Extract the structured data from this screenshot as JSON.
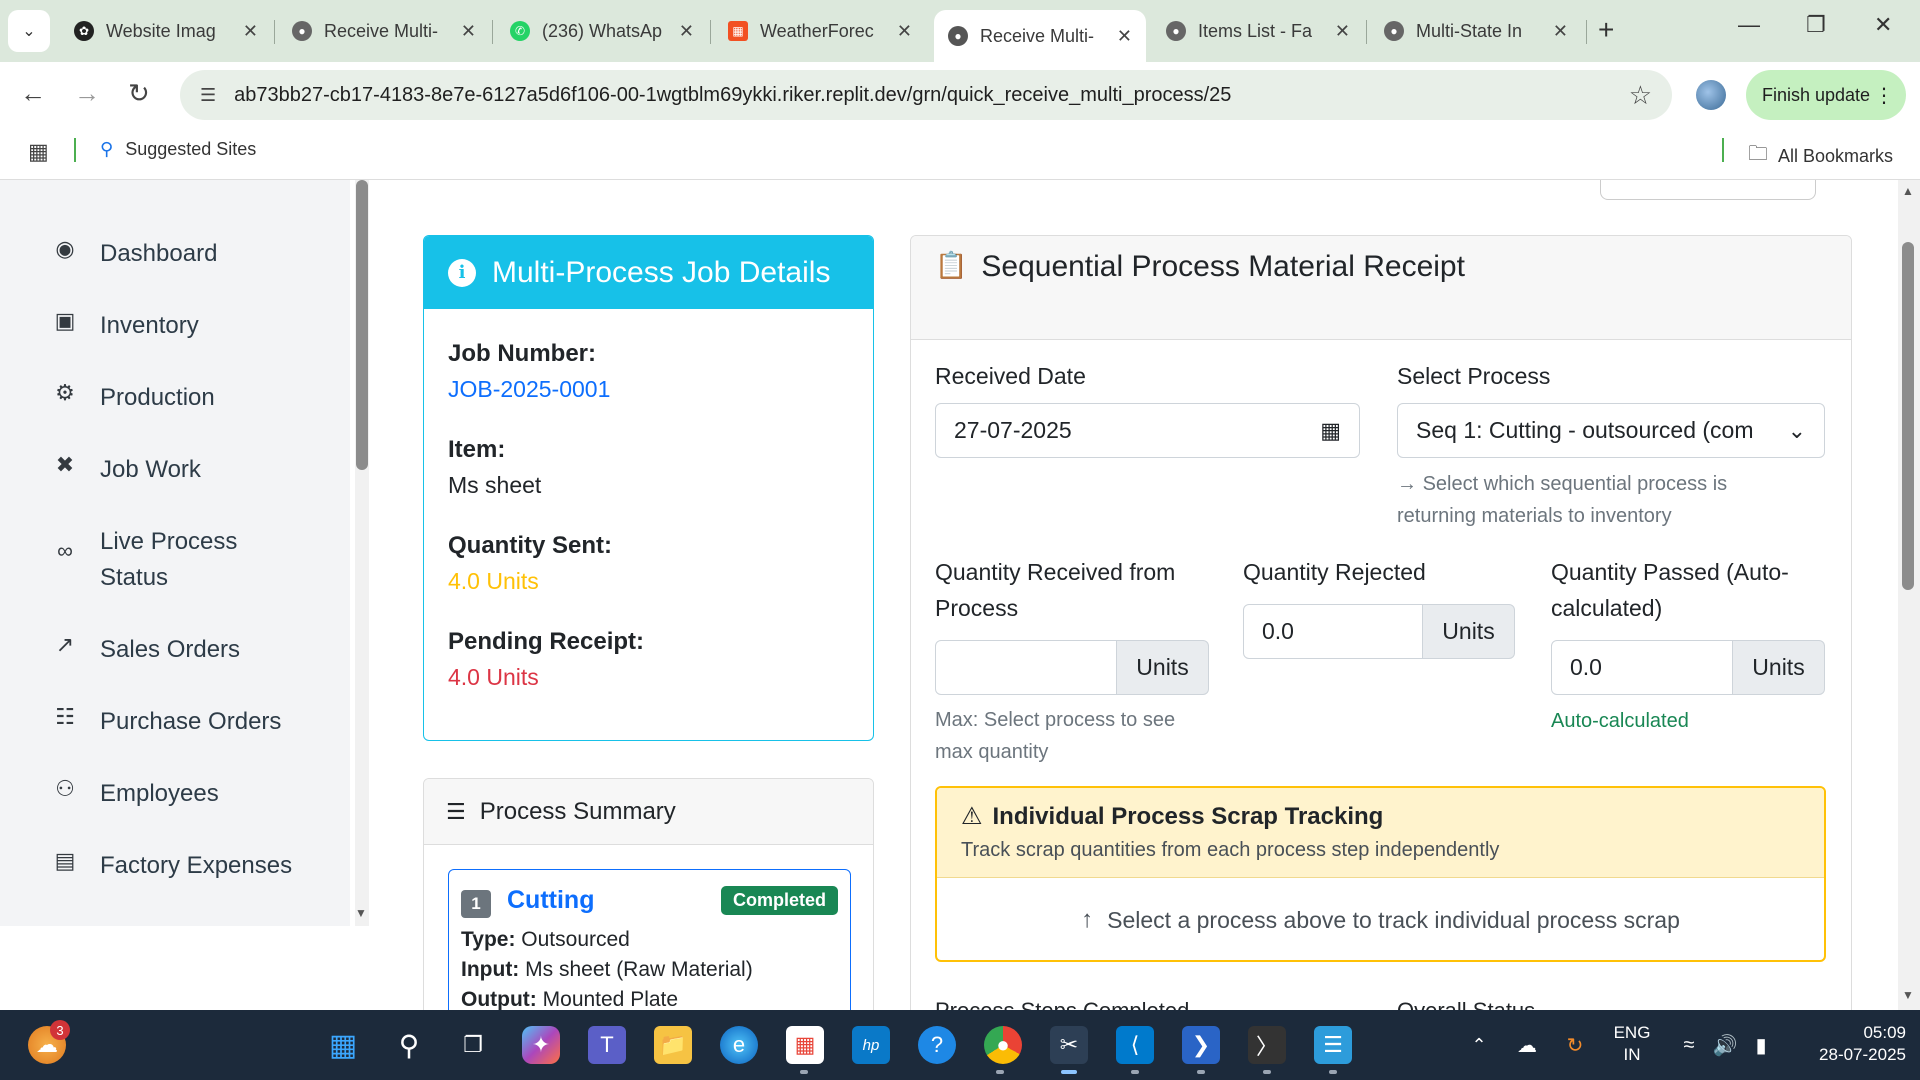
{
  "browser": {
    "tabs": [
      {
        "title": "Website Imag",
        "icon": "openai-icon",
        "color": "#222222"
      },
      {
        "title": "Receive Multi-",
        "icon": "globe-icon",
        "color": "#555555"
      },
      {
        "title": "(236) WhatsAp",
        "icon": "whatsapp-icon",
        "color": "#25d366"
      },
      {
        "title": "WeatherForec",
        "icon": "grid-icon",
        "color": "#f25022"
      },
      {
        "title": "Receive Multi-",
        "icon": "globe-icon",
        "color": "#555555",
        "active": true
      },
      {
        "title": "Items List - Fa",
        "icon": "globe-icon",
        "color": "#555555"
      },
      {
        "title": "Multi-State In",
        "icon": "globe-icon",
        "color": "#555555"
      }
    ],
    "url": "ab73bb27-cb17-4183-8e7e-6127a5d6f106-00-1wgtblm69ykki.riker.replit.dev/grn/quick_receive_multi_process/25",
    "finish_update": "Finish update",
    "bookmarks": {
      "suggested": "Suggested Sites",
      "all": "All Bookmarks"
    }
  },
  "sidebar": {
    "items": [
      {
        "label": "Dashboard",
        "icon": "palette-icon"
      },
      {
        "label": "Inventory",
        "icon": "boxes-icon"
      },
      {
        "label": "Production",
        "icon": "cogs-icon"
      },
      {
        "label": "Job Work",
        "icon": "tools-icon"
      },
      {
        "label": "Live Process\nStatus",
        "icon": "broadcast-icon"
      },
      {
        "label": "Sales Orders",
        "icon": "chart-line-icon"
      },
      {
        "label": "Purchase Orders",
        "icon": "file-invoice-icon"
      },
      {
        "label": "Employees",
        "icon": "users-icon"
      },
      {
        "label": "Factory Expenses",
        "icon": "receipt-icon"
      }
    ]
  },
  "job_details": {
    "title": "Multi-Process Job Details",
    "job_number_label": "Job Number:",
    "job_number": "JOB-2025-0001",
    "item_label": "Item:",
    "item": "Ms sheet",
    "qty_sent_label": "Quantity Sent:",
    "qty_sent": "4.0 Units",
    "pending_label": "Pending Receipt:",
    "pending": "4.0 Units",
    "colors": {
      "info": "#17c1e8",
      "link": "#0d6efd",
      "warning": "#ffc107",
      "danger": "#dc3545"
    }
  },
  "process_summary": {
    "title": "Process Summary",
    "items": [
      {
        "seq": "1",
        "name": "Cutting",
        "status": "Completed",
        "type_label": "Type:",
        "type": "Outsourced",
        "input_label": "Input:",
        "input": "Ms sheet (Raw Material)",
        "output_label": "Output:",
        "output": "Mounted Plate"
      }
    ]
  },
  "receipt": {
    "title": "Sequential Process Material Receipt",
    "received_date_label": "Received Date",
    "received_date": "27-07-2025",
    "select_process_label": "Select Process",
    "select_process_value": "Seq 1: Cutting - outsourced (com",
    "select_process_help": "Select which sequential process is returning materials to inventory",
    "qty_received_label": "Quantity Received from Process",
    "qty_received": "",
    "qty_received_help": "Max: Select process to see max quantity",
    "qty_rejected_label": "Quantity Rejected",
    "qty_rejected": "0.0",
    "qty_passed_label": "Quantity Passed (Auto-calculated)",
    "qty_passed": "0.0",
    "qty_passed_help": "Auto-calculated",
    "unit_addon": "Units",
    "scrap": {
      "title": "Individual Process Scrap Tracking",
      "subtitle": "Track scrap quantities from each process step independently",
      "body": "Select a process above to track individual process scrap"
    },
    "cutoff_left": "Process Steps Completed",
    "cutoff_right": "Overall Status"
  },
  "taskbar": {
    "weather_badge": "3",
    "lang_line1": "ENG",
    "lang_line2": "IN",
    "time": "05:09",
    "date": "28-07-2025"
  }
}
